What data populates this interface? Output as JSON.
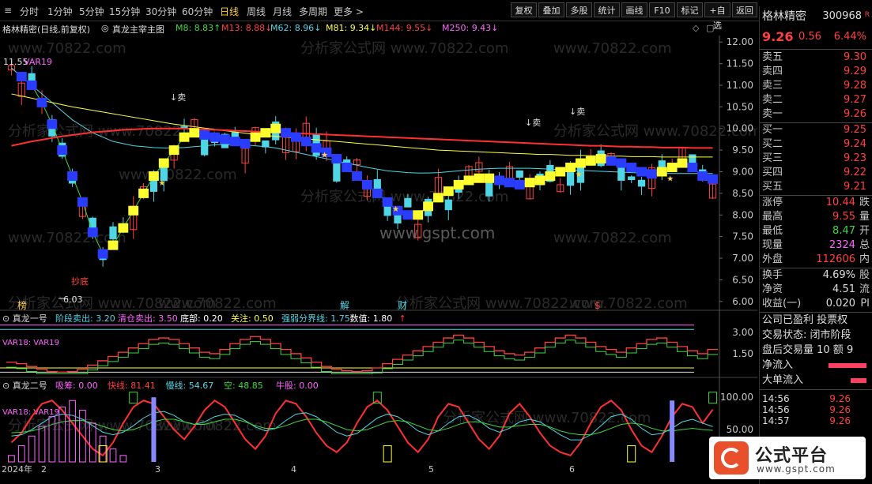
{
  "toolbar": {
    "periods": [
      "分时",
      "1分钟",
      "5分钟",
      "15分钟",
      "30分钟",
      "60分钟",
      "日线",
      "周线",
      "月线",
      "多周期",
      "更多 >"
    ],
    "active_period": "日线",
    "buttons": [
      "复权",
      "叠加",
      "多股",
      "统计",
      "画线",
      "F10",
      "标记",
      "+自选",
      "返回"
    ]
  },
  "stock": {
    "name": "格林精密",
    "code": "300968",
    "flag": "R",
    "price": "9.26",
    "change": "0.56",
    "change_pct": "6.44%"
  },
  "infobar": {
    "title": "格林精密(日线,前复权)",
    "indicator": "真龙主宰主图",
    "ma": [
      {
        "label": "M8: 8.83",
        "arrow": "↑",
        "color": "#3fd63f"
      },
      {
        "label": "M13: 8.88",
        "arrow": "↓",
        "color": "#ff4040"
      },
      {
        "label": "M62: 8.96",
        "arrow": "↓",
        "color": "#4fd6e6"
      },
      {
        "label": "M81: 9.34",
        "arrow": "↓",
        "color": "#ffff40"
      },
      {
        "label": "M144: 9.55",
        "arrow": "↓",
        "color": "#ff4040"
      },
      {
        "label": "M250: 9.43",
        "arrow": "↓",
        "color": "#ff66ff"
      }
    ]
  },
  "watermarks": {
    "text": "www.70822.com",
    "cn": "分析家公式网",
    "center": "www.gspt.com"
  },
  "panel2": {
    "title": "真龙一号",
    "items": [
      {
        "label": "阶段卖出: 3.20",
        "color": "#4fd6e6"
      },
      {
        "label": "清仓卖出: 3.50",
        "color": "#ff66ff"
      },
      {
        "label": "底部: 0.20",
        "color": "#ffffff"
      },
      {
        "label": "关注: 0.50",
        "color": "#ffff40"
      },
      {
        "label": "强弱分界线: 1.75",
        "color": "#4fd6e6"
      },
      {
        "label": "数值: 1.80",
        "color": "#ffffff"
      }
    ],
    "var_label": "VAR18: VAR19"
  },
  "panel3": {
    "title": "真龙二号",
    "items": [
      {
        "label": "吸筹: 0.00",
        "color": "#ff66ff"
      },
      {
        "label": "快线: 81.41",
        "color": "#ff4040"
      },
      {
        "label": "慢线: 54.67",
        "color": "#4fd6e6"
      },
      {
        "label": "空: 48.85",
        "color": "#3fd63f"
      },
      {
        "label": "牛股: 0.00",
        "color": "#ff66ff"
      }
    ],
    "var_label": "VAR18: VAR19"
  },
  "annotations": {
    "high_label": "11.55",
    "low_label": "6.03",
    "buy_bottom": "抄底",
    "sell": "卖",
    "markers": [
      "榜",
      "解",
      "财",
      "$"
    ],
    "var_main": "VAR19"
  },
  "chart_data": [
    {
      "type": "candlestick",
      "title": "",
      "yticks": [
        "12.00",
        "11.50",
        "11.00",
        "10.50",
        "10.00",
        "9.50",
        "9.00",
        "8.50",
        "8.00",
        "7.50",
        "7.00",
        "6.50",
        "6.00"
      ],
      "ylim": [
        5.85,
        12.15
      ],
      "xticks": [
        "2024年",
        "2",
        "3",
        "4",
        "5",
        "6"
      ],
      "series": [
        {
          "name": "M8",
          "values": [
            11.4,
            11.2,
            11.0,
            10.6,
            10.1,
            9.5,
            8.9,
            8.3,
            7.6,
            7.1,
            7.3,
            7.7,
            8.1,
            8.5,
            8.9,
            9.2,
            9.5,
            9.8,
            9.9,
            9.85,
            9.8,
            9.75,
            9.7,
            9.65,
            9.8,
            9.9,
            10.0,
            9.9,
            9.8,
            9.7,
            9.55,
            9.45,
            9.3,
            9.1,
            8.9,
            8.7,
            8.5,
            8.3,
            8.1,
            8.0,
            8.0,
            8.2,
            8.4,
            8.55,
            8.7,
            8.8,
            8.85,
            8.85,
            8.8,
            8.75,
            8.7,
            8.75,
            8.8,
            8.9,
            9.0,
            9.1,
            9.2,
            9.25,
            9.3,
            9.25,
            9.2,
            9.1,
            9.0,
            8.95,
            9.0,
            9.1,
            9.2,
            9.1,
            8.9,
            8.83
          ]
        },
        {
          "name": "M62",
          "values": [
            11.4,
            11.2,
            11.0,
            10.8,
            10.6,
            10.4,
            10.2,
            10.05,
            9.9,
            9.8,
            9.7,
            9.65,
            9.6,
            9.58,
            9.56,
            9.55,
            9.55,
            9.56,
            9.58,
            9.6,
            9.62,
            9.63,
            9.63,
            9.62,
            9.6,
            9.58,
            9.55,
            9.5,
            9.45,
            9.4,
            9.35,
            9.3,
            9.25,
            9.2,
            9.15,
            9.1,
            9.06,
            9.02,
            9.0,
            8.98,
            8.97,
            8.97,
            8.98,
            9.0,
            9.02,
            9.04,
            9.06,
            9.07,
            9.08,
            9.08,
            9.08,
            9.08,
            9.07,
            9.06,
            9.05,
            9.04,
            9.03,
            9.02,
            9.01,
            9.0,
            8.99,
            8.98,
            8.97,
            8.97,
            8.96,
            8.96,
            8.96,
            8.96,
            8.96,
            8.96
          ]
        },
        {
          "name": "M81",
          "values": [
            10.8,
            10.75,
            10.7,
            10.65,
            10.6,
            10.55,
            10.5,
            10.46,
            10.42,
            10.38,
            10.34,
            10.3,
            10.26,
            10.22,
            10.18,
            10.14,
            10.1,
            10.07,
            10.04,
            10.01,
            9.98,
            9.95,
            9.92,
            9.89,
            9.86,
            9.84,
            9.82,
            9.8,
            9.78,
            9.76,
            9.74,
            9.72,
            9.7,
            9.68,
            9.66,
            9.64,
            9.62,
            9.6,
            9.58,
            9.56,
            9.54,
            9.52,
            9.5,
            9.49,
            9.48,
            9.47,
            9.46,
            9.45,
            9.44,
            9.43,
            9.42,
            9.41,
            9.4,
            9.4,
            9.39,
            9.38,
            9.38,
            9.37,
            9.37,
            9.36,
            9.36,
            9.35,
            9.35,
            9.35,
            9.34,
            9.34,
            9.34,
            9.34,
            9.34,
            9.34
          ]
        },
        {
          "name": "M144",
          "values": [
            9.6,
            9.65,
            9.7,
            9.74,
            9.78,
            9.82,
            9.85,
            9.88,
            9.91,
            9.93,
            9.95,
            9.97,
            9.98,
            9.99,
            10.0,
            10.0,
            10.0,
            10.0,
            9.99,
            9.98,
            9.97,
            9.96,
            9.95,
            9.94,
            9.93,
            9.92,
            9.91,
            9.9,
            9.89,
            9.88,
            9.87,
            9.86,
            9.85,
            9.84,
            9.83,
            9.82,
            9.81,
            9.8,
            9.79,
            9.78,
            9.77,
            9.76,
            9.75,
            9.74,
            9.73,
            9.72,
            9.71,
            9.7,
            9.69,
            9.68,
            9.67,
            9.66,
            9.65,
            9.64,
            9.63,
            9.62,
            9.61,
            9.6,
            9.6,
            9.59,
            9.58,
            9.58,
            9.57,
            9.57,
            9.56,
            9.56,
            9.56,
            9.55,
            9.55,
            9.55
          ]
        }
      ]
    },
    {
      "type": "line",
      "title": "",
      "yticks": [
        "3.00",
        "1.50"
      ],
      "ylim": [
        0,
        3.6
      ],
      "series": [
        {
          "name": "数值",
          "values": [
            0.9,
            0.8,
            0.6,
            0.4,
            0.25,
            0.2,
            0.25,
            0.4,
            0.7,
            1.0,
            1.3,
            1.6,
            1.9,
            2.2,
            2.5,
            2.6,
            2.5,
            2.2,
            1.9,
            1.6,
            1.5,
            1.8,
            2.2,
            2.5,
            2.7,
            2.5,
            2.2,
            1.8,
            1.5,
            1.2,
            0.9,
            0.6,
            0.4,
            0.3,
            0.25,
            0.3,
            0.5,
            0.8,
            1.1,
            1.4,
            1.7,
            2.0,
            2.3,
            2.6,
            2.8,
            2.6,
            2.3,
            2.0,
            1.7,
            1.5,
            1.4,
            1.6,
            1.9,
            2.3,
            2.6,
            2.8,
            2.6,
            2.3,
            2.0,
            1.8,
            1.6,
            1.9,
            2.2,
            2.5,
            2.6,
            2.3,
            2.0,
            1.7,
            1.5,
            1.8
          ]
        }
      ]
    },
    {
      "type": "line",
      "title": "",
      "yticks": [
        "100.00",
        "50.00"
      ],
      "ylim": [
        0,
        110
      ],
      "series": [
        {
          "name": "快线",
          "values": [
            30,
            45,
            70,
            90,
            95,
            80,
            60,
            40,
            20,
            10,
            30,
            60,
            85,
            95,
            90,
            70,
            50,
            35,
            55,
            80,
            95,
            85,
            60,
            35,
            20,
            40,
            75,
            95,
            90,
            70,
            45,
            25,
            15,
            30,
            60,
            85,
            95,
            80,
            55,
            30,
            15,
            35,
            70,
            90,
            85,
            60,
            35,
            20,
            40,
            75,
            90,
            70,
            45,
            25,
            15,
            10,
            30,
            60,
            85,
            95,
            80,
            50,
            25,
            15,
            40,
            70,
            90,
            85,
            60,
            81
          ]
        },
        {
          "name": "慢线",
          "values": [
            40,
            42,
            50,
            60,
            70,
            74,
            72,
            66,
            56,
            46,
            42,
            46,
            56,
            68,
            76,
            78,
            72,
            62,
            58,
            62,
            70,
            74,
            72,
            64,
            54,
            48,
            52,
            64,
            74,
            76,
            70,
            58,
            46,
            40,
            44,
            56,
            68,
            74,
            70,
            60,
            48,
            42,
            48,
            60,
            70,
            72,
            64,
            52,
            46,
            52,
            62,
            66,
            62,
            52,
            42,
            34,
            34,
            42,
            56,
            70,
            74,
            66,
            52,
            42,
            44,
            52,
            62,
            66,
            60,
            54.67
          ]
        },
        {
          "name": "空",
          "values": [
            45,
            46,
            48,
            52,
            58,
            62,
            64,
            64,
            60,
            55,
            50,
            48,
            50,
            56,
            62,
            66,
            66,
            62,
            58,
            58,
            62,
            66,
            66,
            62,
            56,
            52,
            52,
            56,
            62,
            66,
            66,
            62,
            56,
            50,
            48,
            50,
            56,
            62,
            64,
            62,
            56,
            50,
            48,
            52,
            58,
            62,
            62,
            58,
            54,
            54,
            56,
            58,
            58,
            54,
            48,
            44,
            42,
            42,
            46,
            52,
            58,
            60,
            58,
            52,
            48,
            48,
            50,
            52,
            50,
            48.85
          ]
        }
      ]
    }
  ],
  "right_panel": {
    "asks": [
      {
        "label": "卖五",
        "value": "9.30"
      },
      {
        "label": "卖四",
        "value": "9.29"
      },
      {
        "label": "卖三",
        "value": "9.28"
      },
      {
        "label": "卖二",
        "value": "9.27"
      },
      {
        "label": "卖一",
        "value": "9.26"
      }
    ],
    "bids": [
      {
        "label": "买一",
        "value": "9.25"
      },
      {
        "label": "买二",
        "value": "9.24"
      },
      {
        "label": "买三",
        "value": "9.23"
      },
      {
        "label": "买四",
        "value": "9.22"
      },
      {
        "label": "买五",
        "value": "9.21"
      }
    ],
    "stats": [
      {
        "label": "涨停",
        "value": "10.44",
        "suffix": "跌",
        "color": "#ff4040"
      },
      {
        "label": "最高",
        "value": "9.55",
        "suffix": "量",
        "color": "#ff4040"
      },
      {
        "label": "最低",
        "value": "8.47",
        "suffix": "开",
        "color": "#3fd63f"
      },
      {
        "label": "现量",
        "value": "2324",
        "suffix": "总",
        "color": "#ff66ff"
      },
      {
        "label": "外盘",
        "value": "112606",
        "suffix": "内",
        "color": "#ff4040"
      }
    ],
    "stats2": [
      {
        "label": "换手",
        "value": "4.69%",
        "suffix": "股"
      },
      {
        "label": "净资",
        "value": "4.51",
        "suffix": "流"
      },
      {
        "label": "收益(一)",
        "value": "0.020",
        "suffix": "PI"
      }
    ],
    "company": [
      "公司已盈利 投票权",
      "交易状态: 闭市阶段",
      "盘后交易量 10 额 9"
    ],
    "flows": [
      {
        "label": "净流入"
      },
      {
        "label": "大单流入"
      }
    ],
    "ticks": [
      {
        "time": "14:56",
        "price": "9.26"
      },
      {
        "time": "14:56",
        "price": "9.26"
      },
      {
        "time": "14:57",
        "price": "9.26"
      }
    ]
  },
  "logo": {
    "title": "公式平台",
    "url": "www.gspt.com"
  }
}
